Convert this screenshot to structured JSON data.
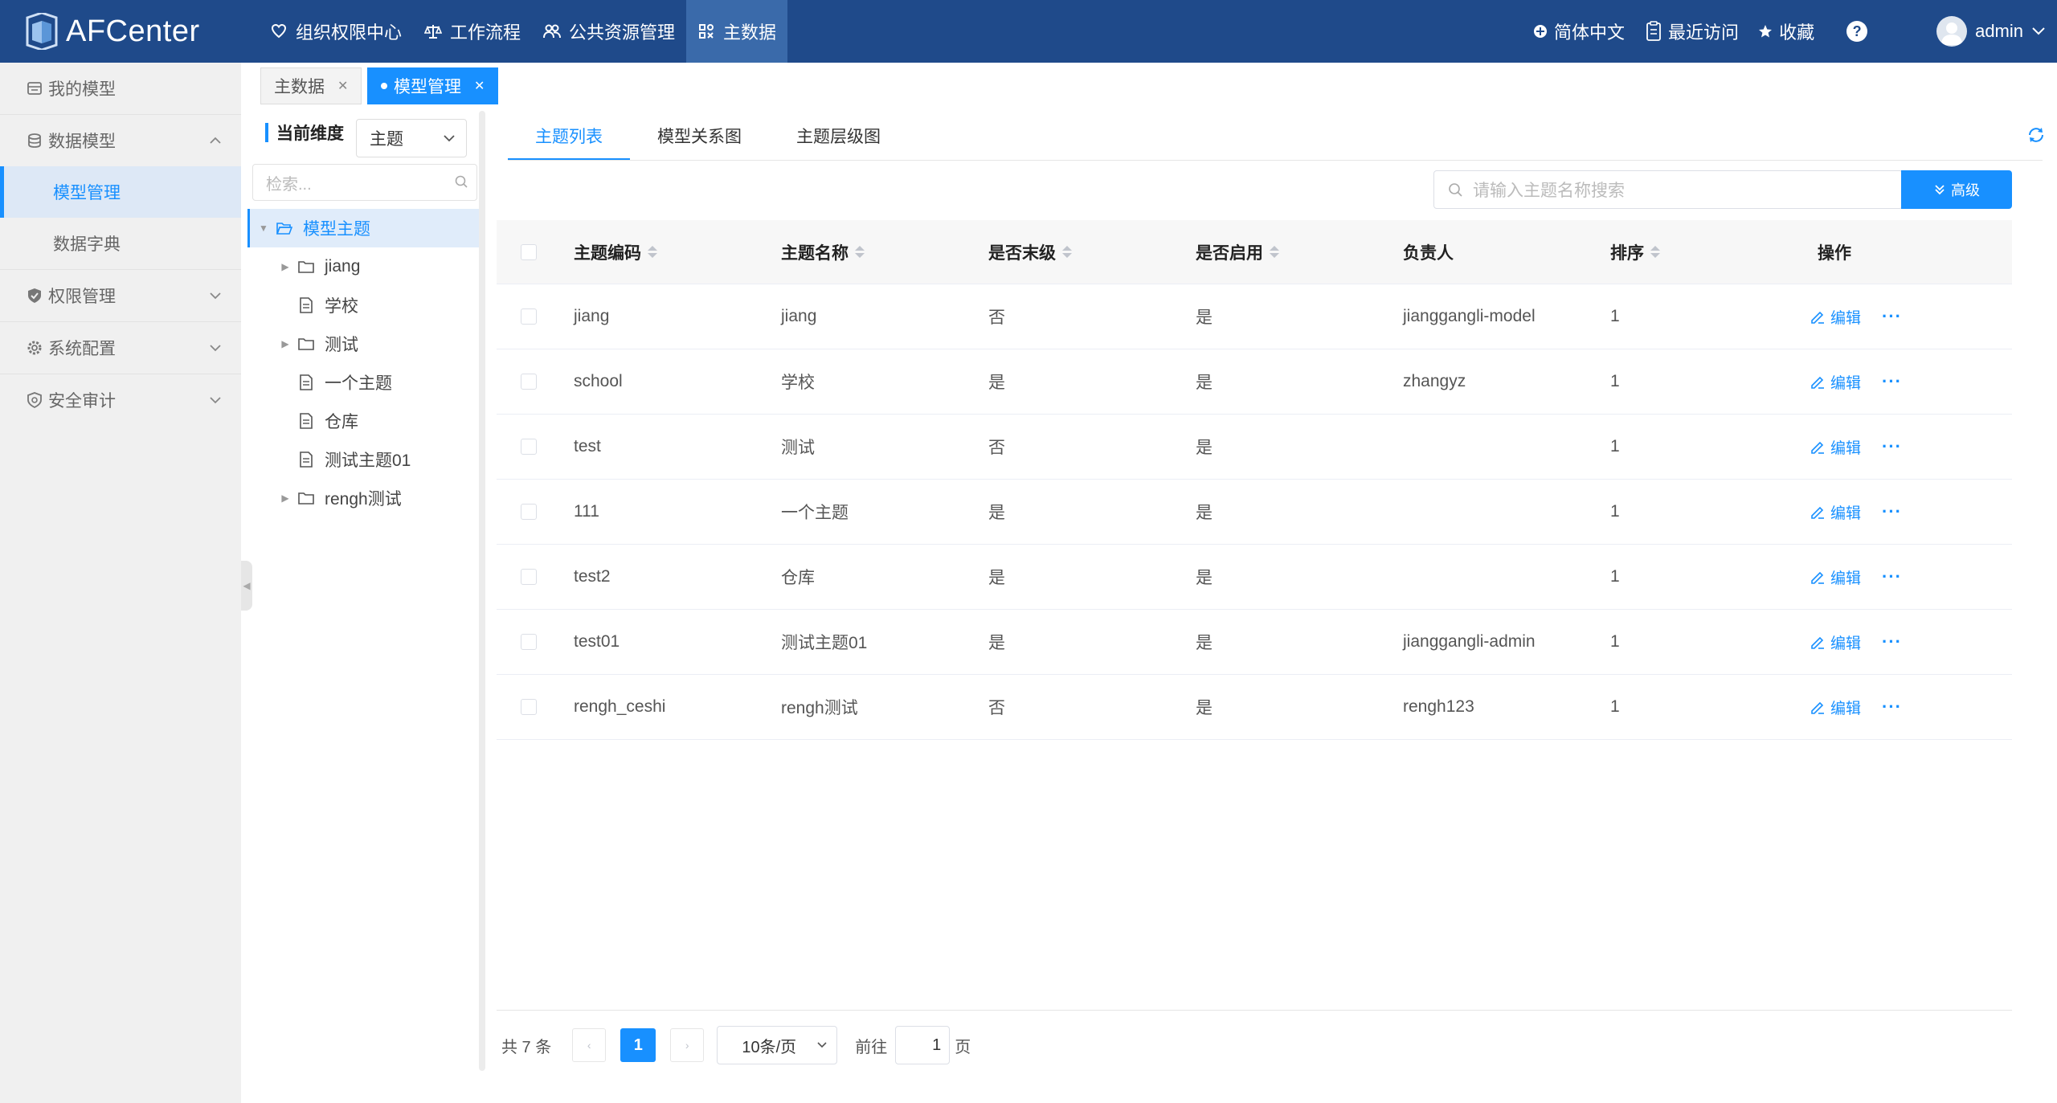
{
  "brand": {
    "name": "AFCenter"
  },
  "topnav": [
    {
      "label": "组织权限中心",
      "icon": "heart-shield-icon",
      "active": false
    },
    {
      "label": "工作流程",
      "icon": "scale-icon",
      "active": false
    },
    {
      "label": "公共资源管理",
      "icon": "people-icon",
      "active": false
    },
    {
      "label": "主数据",
      "icon": "cube-icon",
      "active": true
    }
  ],
  "topright": {
    "language": "简体中文",
    "recent": "最近访问",
    "favorites": "收藏",
    "user": "admin"
  },
  "sidebar": {
    "items": [
      {
        "label": "我的模型",
        "icon": "model-icon"
      },
      {
        "label": "数据模型",
        "icon": "database-icon",
        "expanded": true,
        "children": [
          {
            "label": "模型管理",
            "active": true
          },
          {
            "label": "数据字典",
            "active": false
          }
        ]
      },
      {
        "label": "权限管理",
        "icon": "shield-icon"
      },
      {
        "label": "系统配置",
        "icon": "gear-icon"
      },
      {
        "label": "安全审计",
        "icon": "audit-icon"
      }
    ]
  },
  "tabs": [
    {
      "label": "主数据",
      "active": false
    },
    {
      "label": "模型管理",
      "active": true
    }
  ],
  "tree": {
    "dimension_label": "当前维度",
    "dimension_value": "主题",
    "search_placeholder": "检索...",
    "nodes": [
      {
        "label": "模型主题",
        "type": "folder",
        "level": 0,
        "expandable": true,
        "selected": true
      },
      {
        "label": "jiang",
        "type": "folder",
        "level": 1,
        "expandable": true
      },
      {
        "label": "学校",
        "type": "file",
        "level": 1,
        "expandable": false
      },
      {
        "label": "测试",
        "type": "folder",
        "level": 1,
        "expandable": true
      },
      {
        "label": "一个主题",
        "type": "file",
        "level": 1,
        "expandable": false
      },
      {
        "label": "仓库",
        "type": "file",
        "level": 1,
        "expandable": false
      },
      {
        "label": "测试主题01",
        "type": "file",
        "level": 1,
        "expandable": false
      },
      {
        "label": "rengh测试",
        "type": "folder",
        "level": 1,
        "expandable": true
      }
    ]
  },
  "subtabs": [
    {
      "label": "主题列表",
      "active": true
    },
    {
      "label": "模型关系图",
      "active": false
    },
    {
      "label": "主题层级图",
      "active": false
    }
  ],
  "search": {
    "placeholder": "请输入主题名称搜索",
    "advanced_label": "高级"
  },
  "table": {
    "columns": [
      {
        "label": "主题编码",
        "sortable": true
      },
      {
        "label": "主题名称",
        "sortable": true
      },
      {
        "label": "是否末级",
        "sortable": true
      },
      {
        "label": "是否启用",
        "sortable": true
      },
      {
        "label": "负责人",
        "sortable": false
      },
      {
        "label": "排序",
        "sortable": true
      },
      {
        "label": "操作",
        "sortable": false
      }
    ],
    "edit_label": "编辑",
    "more_label": "···",
    "rows": [
      {
        "code": "jiang",
        "name": "jiang",
        "is_leaf": "否",
        "enabled": "是",
        "owner": "jianggangli-model",
        "order": "1"
      },
      {
        "code": "school",
        "name": "学校",
        "is_leaf": "是",
        "enabled": "是",
        "owner": "zhangyz",
        "order": "1"
      },
      {
        "code": "test",
        "name": "测试",
        "is_leaf": "否",
        "enabled": "是",
        "owner": "",
        "order": "1"
      },
      {
        "code": "111",
        "name": "一个主题",
        "is_leaf": "是",
        "enabled": "是",
        "owner": "",
        "order": "1"
      },
      {
        "code": "test2",
        "name": "仓库",
        "is_leaf": "是",
        "enabled": "是",
        "owner": "",
        "order": "1"
      },
      {
        "code": "test01",
        "name": "测试主题01",
        "is_leaf": "是",
        "enabled": "是",
        "owner": "jianggangli-admin",
        "order": "1"
      },
      {
        "code": "rengh_ceshi",
        "name": "rengh测试",
        "is_leaf": "否",
        "enabled": "是",
        "owner": "rengh123",
        "order": "1"
      }
    ]
  },
  "pagination": {
    "total_text": "共 7 条",
    "current_page": "1",
    "page_size": "10条/页",
    "goto_prefix": "前往",
    "goto_value": "1",
    "goto_suffix": "页"
  },
  "colors": {
    "topbar": "#1f4a8a",
    "accent": "#1890ff",
    "sidebar_bg": "#f0f0f0"
  }
}
